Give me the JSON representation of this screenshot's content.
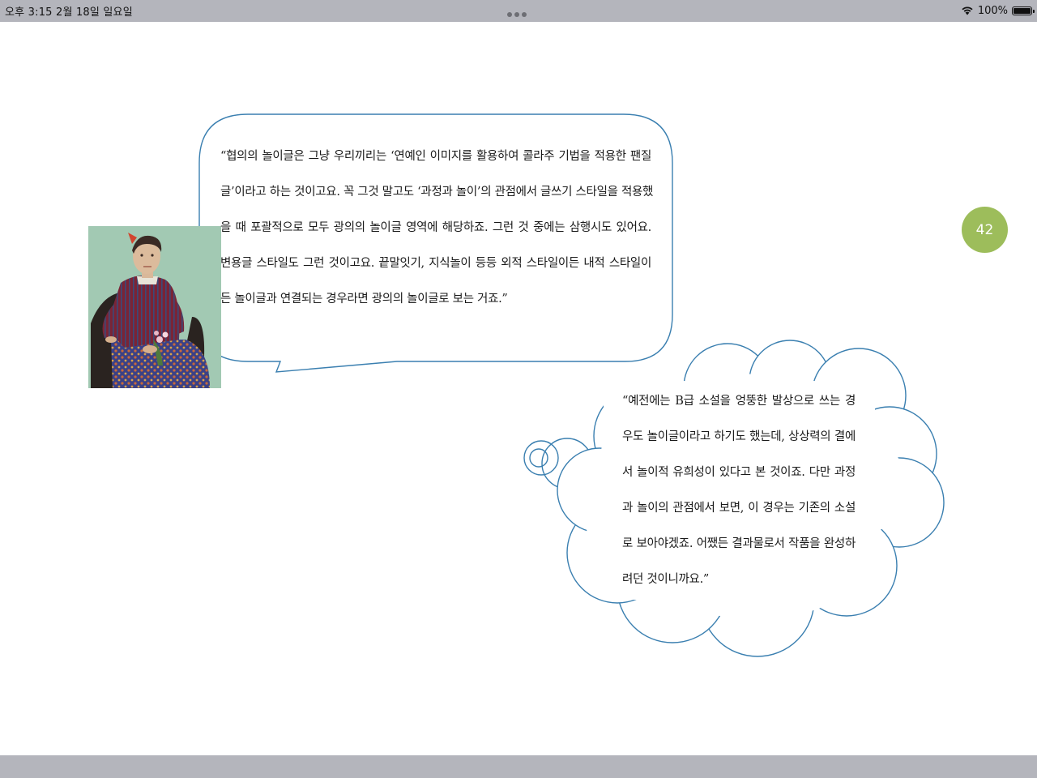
{
  "status_bar": {
    "time_date": "오후 3:15   2월 18일 일요일",
    "battery_percent": "100%",
    "battery_level": 1.0,
    "icons": [
      "multitask-dots-icon",
      "wifi-icon",
      "battery-icon"
    ]
  },
  "page": {
    "page_number": "42",
    "accent_color": "#9dbd5b",
    "bubble_stroke_color": "#3a7fb0"
  },
  "speech_bubble": {
    "lines": [
      "“협의의 놀이글은 그냥 우리끼리는 ‘연예인 이미지를 활용하여 콜라주 기법을 적용한 팬질",
      "글’이라고 하는 것이고요. 꼭 그것 말고도 ‘과정과 놀이’의 관점에서 글쓰기 스타일을 적용했",
      "을 때 포괄적으로 모두 광의의 놀이글 영역에 해당하죠. 그런 것 중에는 삼행시도 있어요.",
      "변용글 스타일도 그런 것이고요. 끝말잇기, 지식놀이 등등 외적 스타일이든 내적 스타일이",
      "든 놀이글과 연결되는 경우라면 광의의 놀이글로 보는 거죠.”"
    ]
  },
  "thought_bubble": {
    "lines": [
      "“예전에는 B급 소설을 엉뚱한 발상으로 쓰는 경",
      "우도 놀이글이라고 하기도 했는데, 상상력의 결에",
      "서 놀이적 유희성이 있다고 본 것이죠. 다만 과정",
      "과 놀이의 관점에서 보면, 이 경우는 기존의 소설",
      "로 보아야겠죠. 어쨌든 결과물로서 작품을 완성하",
      "려던 것이니까요.”"
    ]
  }
}
